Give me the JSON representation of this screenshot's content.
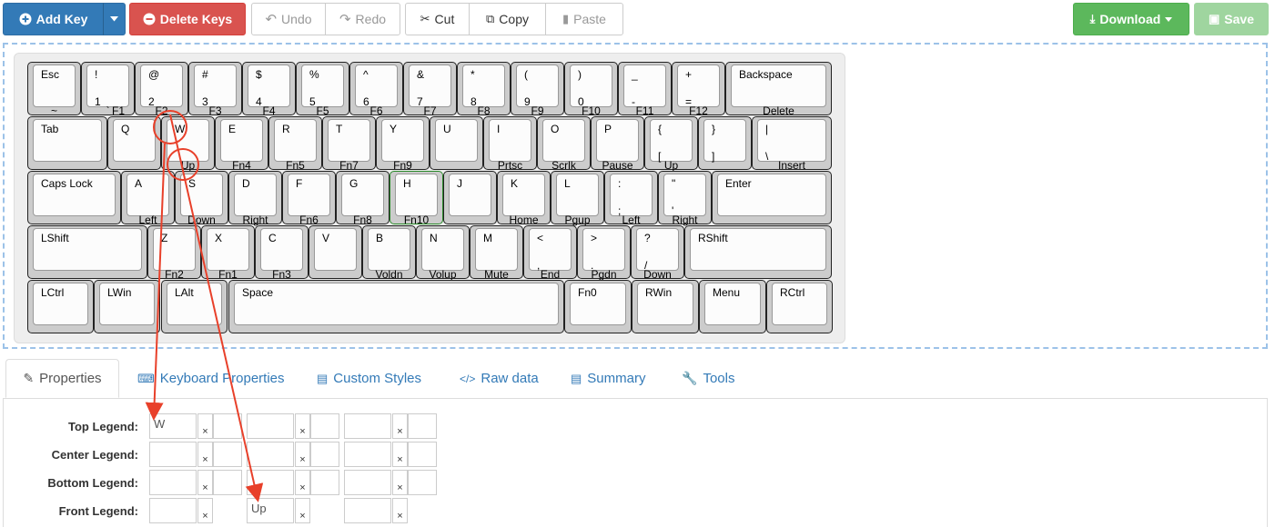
{
  "toolbar": {
    "add_key": "Add Key",
    "delete_keys": "Delete Keys",
    "undo": "Undo",
    "redo": "Redo",
    "cut": "Cut",
    "copy": "Copy",
    "paste": "Paste",
    "download": "Download",
    "save": "Save"
  },
  "keys": [
    {
      "tl": "Esc",
      "fc": "~"
    },
    {
      "tl": "!",
      "bl": "1",
      "fc": "`",
      "fr": "F1"
    },
    {
      "tl": "@",
      "bl": "2",
      "fc": "F2"
    },
    {
      "tl": "#",
      "bl": "3",
      "fc": "F3"
    },
    {
      "tl": "$",
      "bl": "4",
      "fc": "F4"
    },
    {
      "tl": "%",
      "bl": "5",
      "fc": "F5"
    },
    {
      "tl": "^",
      "bl": "6",
      "fc": "F6"
    },
    {
      "tl": "&",
      "bl": "7",
      "fc": "F7"
    },
    {
      "tl": "*",
      "bl": "8",
      "fc": "F8"
    },
    {
      "tl": "(",
      "bl": "9",
      "fc": "F9"
    },
    {
      "tl": ")",
      "bl": "0",
      "fc": "F10"
    },
    {
      "tl": "_",
      "bl": "-",
      "fc": "F11"
    },
    {
      "tl": "+",
      "bl": "=",
      "fc": "F12"
    },
    {
      "tl": "Backspace",
      "fc": "Delete"
    },
    {
      "tl": "Tab"
    },
    {
      "tl": "Q"
    },
    {
      "tl": "W",
      "fc": "Up"
    },
    {
      "tl": "E",
      "fc": "Fn4"
    },
    {
      "tl": "R",
      "fc": "Fn5"
    },
    {
      "tl": "T",
      "fc": "Fn7"
    },
    {
      "tl": "Y",
      "fc": "Fn9"
    },
    {
      "tl": "U"
    },
    {
      "tl": "I",
      "fc": "Prtsc"
    },
    {
      "tl": "O",
      "fc": "Scrlk"
    },
    {
      "tl": "P",
      "fc": "Pause"
    },
    {
      "tl": "{",
      "bl": "[",
      "fc": "Up"
    },
    {
      "tl": "}",
      "bl": "]"
    },
    {
      "tl": "|",
      "bl": "\\",
      "fc": "Insert"
    },
    {
      "tl": "Caps Lock"
    },
    {
      "tl": "A",
      "fc": "Left"
    },
    {
      "tl": "S",
      "fc": "Down"
    },
    {
      "tl": "D",
      "fc": "Right"
    },
    {
      "tl": "F",
      "fc": "Fn6"
    },
    {
      "tl": "G",
      "fc": "Fn8"
    },
    {
      "tl": "H",
      "fc": "Fn10"
    },
    {
      "tl": "J"
    },
    {
      "tl": "K",
      "fc": "Home"
    },
    {
      "tl": "L",
      "fc": "Pgup"
    },
    {
      "tl": ":",
      "bl": ";",
      "fc": "Left"
    },
    {
      "tl": "\"",
      "bl": "'",
      "fc": "Right"
    },
    {
      "tl": "Enter"
    },
    {
      "tl": "LShift"
    },
    {
      "tl": "Z",
      "fc": "Fn2"
    },
    {
      "tl": "X",
      "fc": "Fn1"
    },
    {
      "tl": "C",
      "fc": "Fn3"
    },
    {
      "tl": "V"
    },
    {
      "tl": "B",
      "fc": "Voldn"
    },
    {
      "tl": "N",
      "fc": "Volup"
    },
    {
      "tl": "M",
      "fc": "Mute"
    },
    {
      "tl": "<",
      "bl": ",",
      "fc": "End"
    },
    {
      "tl": ">",
      "bl": ".",
      "fc": "Pgdn"
    },
    {
      "tl": "?",
      "bl": "/",
      "fc": "Down"
    },
    {
      "tl": "RShift"
    },
    {
      "tl": "LCtrl"
    },
    {
      "tl": "LWin"
    },
    {
      "tl": "LAlt"
    },
    {
      "tl": "Space"
    },
    {
      "tl": "Fn0"
    },
    {
      "tl": "RWin"
    },
    {
      "tl": "Menu"
    },
    {
      "tl": "RCtrl"
    }
  ],
  "tabs": [
    {
      "label": "Properties",
      "icon": "edit-icon"
    },
    {
      "label": "Keyboard Properties",
      "icon": "keyboard-icon"
    },
    {
      "label": "Custom Styles",
      "icon": "file-icon"
    },
    {
      "label": "Raw data",
      "icon": "code-icon"
    },
    {
      "label": "Summary",
      "icon": "file-icon"
    },
    {
      "label": "Tools",
      "icon": "wrench-icon"
    }
  ],
  "properties": {
    "rows": [
      {
        "label": "Top Legend:",
        "values": [
          "W",
          "",
          "",
          "",
          "",
          ""
        ]
      },
      {
        "label": "Center Legend:",
        "values": [
          "",
          "",
          "",
          "",
          "",
          ""
        ]
      },
      {
        "label": "Bottom Legend:",
        "values": [
          "",
          "",
          "",
          "",
          "",
          ""
        ]
      },
      {
        "label": "Front Legend:",
        "values": [
          "",
          "Up",
          ""
        ]
      }
    ],
    "clear_glyph": "×"
  },
  "colors": {
    "primary": "#337ab7",
    "danger": "#d9534f",
    "success": "#5cb85c",
    "annotation": "#e8402a",
    "selected_key": "#2a8a2a"
  }
}
